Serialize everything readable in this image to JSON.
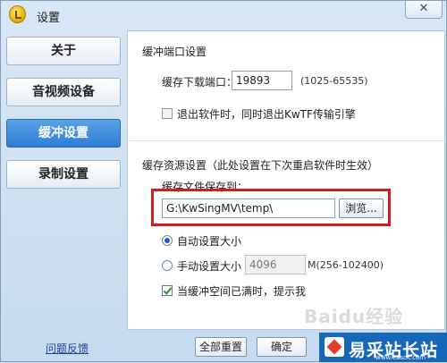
{
  "window": {
    "title": "设置",
    "close_glyph": "✕"
  },
  "sidebar": {
    "items": [
      {
        "label": "关于",
        "active": false
      },
      {
        "label": "音视频设备",
        "active": false
      },
      {
        "label": "缓冲设置",
        "active": true
      },
      {
        "label": "录制设置",
        "active": false
      }
    ]
  },
  "port_section": {
    "title": "缓冲端口设置",
    "port_label": "缓存下载端口：",
    "port_value": "19893",
    "port_range": "(1025-65535)",
    "exit_checkbox_label": "退出软件时，同时退出KwTF传输引擎",
    "exit_checked": false
  },
  "resource_section": {
    "title": "缓存资源设置（此处设置在下次重启软件时生效）",
    "path_label": "缓存文件保存到：",
    "path_value": "G:\\KwSingMV\\temp\\",
    "browse_label": "浏览...",
    "auto_size_label": "自动设置大小",
    "manual_size_label": "手动设置大小",
    "manual_size_value": "4096",
    "manual_size_range": "M(256-102400)",
    "notify_label": "当缓冲空间已满时，提示我",
    "notify_checked": true
  },
  "bottom": {
    "feedback_link": "问题反馈",
    "reset_label": "全部重置",
    "ok_label": "确定"
  },
  "watermarks": {
    "baidu": "Baidu经验",
    "site_name": "易采站长站",
    "site_url": "www.easck.com"
  },
  "colors": {
    "accent": "#2f7cd4",
    "highlight": "#d21e1e",
    "watermark_bg": "#1767b8"
  }
}
